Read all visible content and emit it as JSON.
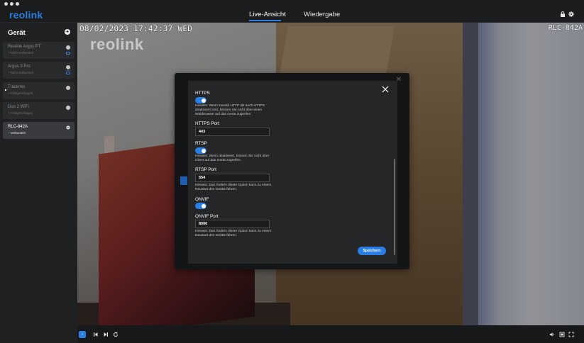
{
  "header": {
    "logo": "reolink",
    "tabs": [
      {
        "label": "Live-Ansicht",
        "active": true
      },
      {
        "label": "Wiedergabe",
        "active": false
      }
    ],
    "icons": [
      "lock-icon",
      "settings-gear-icon"
    ]
  },
  "sidebar": {
    "title": "Gerät",
    "cameras": [
      {
        "name": "Reolink Argus PT",
        "status": "Nicht verbunden",
        "active": false
      },
      {
        "name": "Argus 3 Pro",
        "status": "Nicht verbunden",
        "active": false
      },
      {
        "name": "Trackmix",
        "status": "Fehlgeschlagen",
        "active": false
      },
      {
        "name": "Duo 2 WiFi",
        "status": "Fehlgeschlagen",
        "active": false
      },
      {
        "name": "RLC-842A",
        "status": "Verbunden",
        "active": true
      }
    ]
  },
  "video": {
    "osd_timestamp": "08/02/2023 17:42:37 WED",
    "osd_camera": "RLC-842A",
    "watermark": "reolink"
  },
  "dialog": {
    "https": {
      "label": "HTTPS",
      "enabled": true,
      "hint": "Hinweis: Wenn sowohl HTTP als auch HTTPS deaktiviert sind, können Sie nicht über einen Webbrowser auf das Gerät zugreifen."
    },
    "https_port": {
      "label": "HTTPS Port",
      "value": "443"
    },
    "rtsp": {
      "label": "RTSP",
      "enabled": true,
      "hint": "Hinweis: Wenn deaktiviert, können Sie nicht über Client auf das Gerät zugreifen."
    },
    "rtsp_port": {
      "label": "RTSP Port",
      "value": "554",
      "hint": "Hinweis: Das Ändern dieser Option kann zu einem Neustart des Geräts führen."
    },
    "onvif": {
      "label": "ONVIF",
      "enabled": true
    },
    "onvif_port": {
      "label": "ONVIF Port",
      "value": "8000",
      "hint": "Hinweis: Das Ändern dieser Option kann zu einem Neustart des Geräts führen."
    },
    "save_label": "Speichern"
  },
  "colors": {
    "accent": "#2a7de1",
    "connected": "#3fbf4a",
    "error": "#d0382f"
  }
}
